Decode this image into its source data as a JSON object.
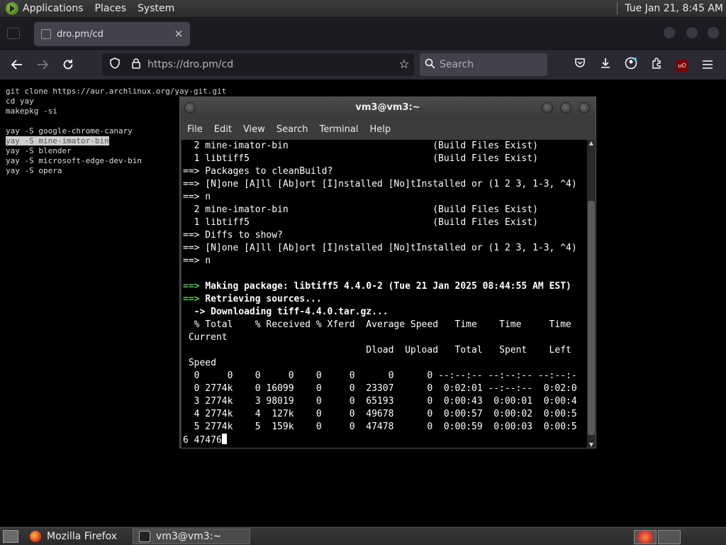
{
  "top_panel": {
    "menus": [
      "Applications",
      "Places",
      "System"
    ],
    "clock": "Tue Jan 21,  8:45 AM"
  },
  "browser": {
    "tab_title": "dro.pm/cd",
    "url": "https://dro.pm/cd",
    "search_placeholder": "Search"
  },
  "page_text": {
    "lines": [
      "git clone https://aur.archlinux.org/yay-git.git",
      "cd yay",
      "makepkg -si",
      "",
      "yay -S google-chrome-canary",
      "yay -S mine-imator-bin",
      "yay -S blender",
      "yay -S microsoft-edge-dev-bin",
      "yay -S opera"
    ],
    "highlighted_index": 5
  },
  "terminal": {
    "title": "vm3@vm3:~",
    "menu": [
      "File",
      "Edit",
      "View",
      "Search",
      "Terminal",
      "Help"
    ],
    "lines": [
      {
        "t": "  2 mine-imator-bin                          (Build Files Exist)"
      },
      {
        "t": "  1 libtiff5                                 (Build Files Exist)"
      },
      {
        "t": "==> Packages to cleanBuild?"
      },
      {
        "t": "==> [N]one [A]ll [Ab]ort [I]nstalled [No]tInstalled or (1 2 3, 1-3, ^4)"
      },
      {
        "t": "==> n"
      },
      {
        "t": "  2 mine-imator-bin                          (Build Files Exist)"
      },
      {
        "t": "  1 libtiff5                                 (Build Files Exist)"
      },
      {
        "t": "==> Diffs to show?"
      },
      {
        "t": "==> [N]one [A]ll [Ab]ort [I]nstalled [No]tInstalled or (1 2 3, 1-3, ^4)"
      },
      {
        "t": "==> n"
      },
      {
        "t": ""
      },
      {
        "p": "==> ",
        "t": "Making package: libtiff5 4.4.0-2 (Tue 21 Jan 2025 08:44:55 AM EST)",
        "style": "green"
      },
      {
        "p": "==> ",
        "t": "Retrieving sources...",
        "style": "green"
      },
      {
        "t": "  -> Downloading tiff-4.4.0.tar.gz...",
        "style": "bold"
      },
      {
        "t": "  % Total    % Received % Xferd  Average Speed   Time    Time     Time"
      },
      {
        "t": " Current"
      },
      {
        "t": "                                 Dload  Upload   Total   Spent    Left"
      },
      {
        "t": " Speed"
      },
      {
        "t": "  0     0    0     0    0     0      0      0 --:--:-- --:--:-- --:--:-"
      },
      {
        "t": "  0 2774k    0 16099    0     0  23307      0  0:02:01 --:--:--  0:02:0"
      },
      {
        "t": "  3 2774k    3 98019    0     0  65193      0  0:00:43  0:00:01  0:00:4"
      },
      {
        "t": "  4 2774k    4  127k    0     0  49678      0  0:00:57  0:00:02  0:00:5"
      },
      {
        "t": "  5 2774k    5  159k    0     0  47478      0  0:00:59  0:00:03  0:00:5"
      },
      {
        "t": "6 47476",
        "cursor": true
      }
    ]
  },
  "taskbar": {
    "tasks": [
      {
        "label": "Mozilla Firefox",
        "icon": "firefox-icon",
        "active": false
      },
      {
        "label": "vm3@vm3:~",
        "icon": "terminal-icon",
        "active": true
      }
    ]
  },
  "colors": {
    "terminal_green": "#4dd24d",
    "browser_bg": "#1c1b22"
  }
}
